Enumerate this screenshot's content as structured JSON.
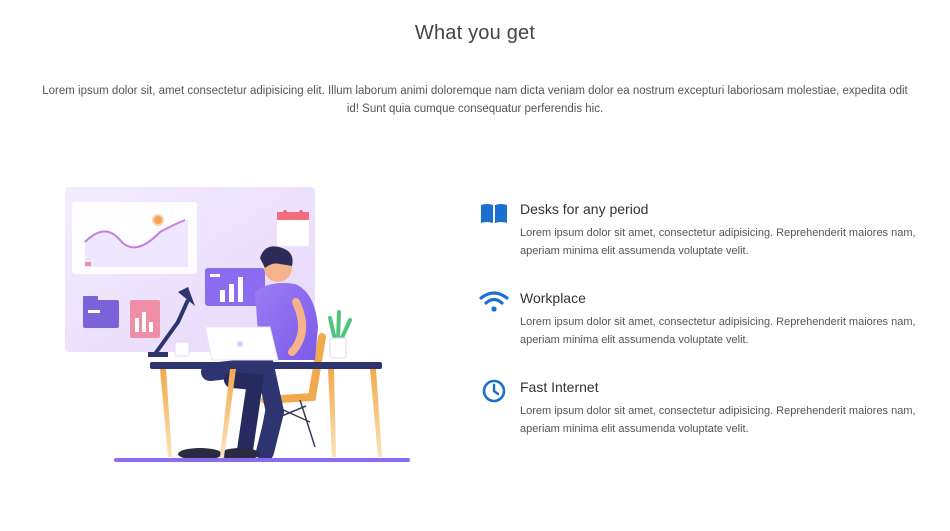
{
  "section": {
    "title": "What you get",
    "description": "Lorem ipsum dolor sit, amet consectetur adipisicing elit. Illum laborum animi doloremque nam dicta veniam dolor ea nostrum excepturi laboriosam molestiae, expedita odit id! Sunt quia cumque consequatur perferendis hic."
  },
  "features": [
    {
      "icon": "book-icon",
      "title": "Desks for any period",
      "text": "Lorem ipsum dolor sit amet, consectetur adipisicing. Reprehenderit maiores nam, aperiam minima elit assumenda voluptate velit."
    },
    {
      "icon": "wifi-icon",
      "title": "Workplace",
      "text": "Lorem ipsum dolor sit amet, consectetur adipisicing. Reprehenderit maiores nam, aperiam minima elit assumenda voluptate velit."
    },
    {
      "icon": "clock-icon",
      "title": "Fast Internet",
      "text": "Lorem ipsum dolor sit amet, consectetur adipisicing. Reprehenderit maiores nam, aperiam minima elit assumenda voluptate velit."
    }
  ],
  "colors": {
    "accent": "#1a6fd1",
    "title": "#444444",
    "text": "#555555",
    "illustration_purple": "#8b6cf0"
  }
}
